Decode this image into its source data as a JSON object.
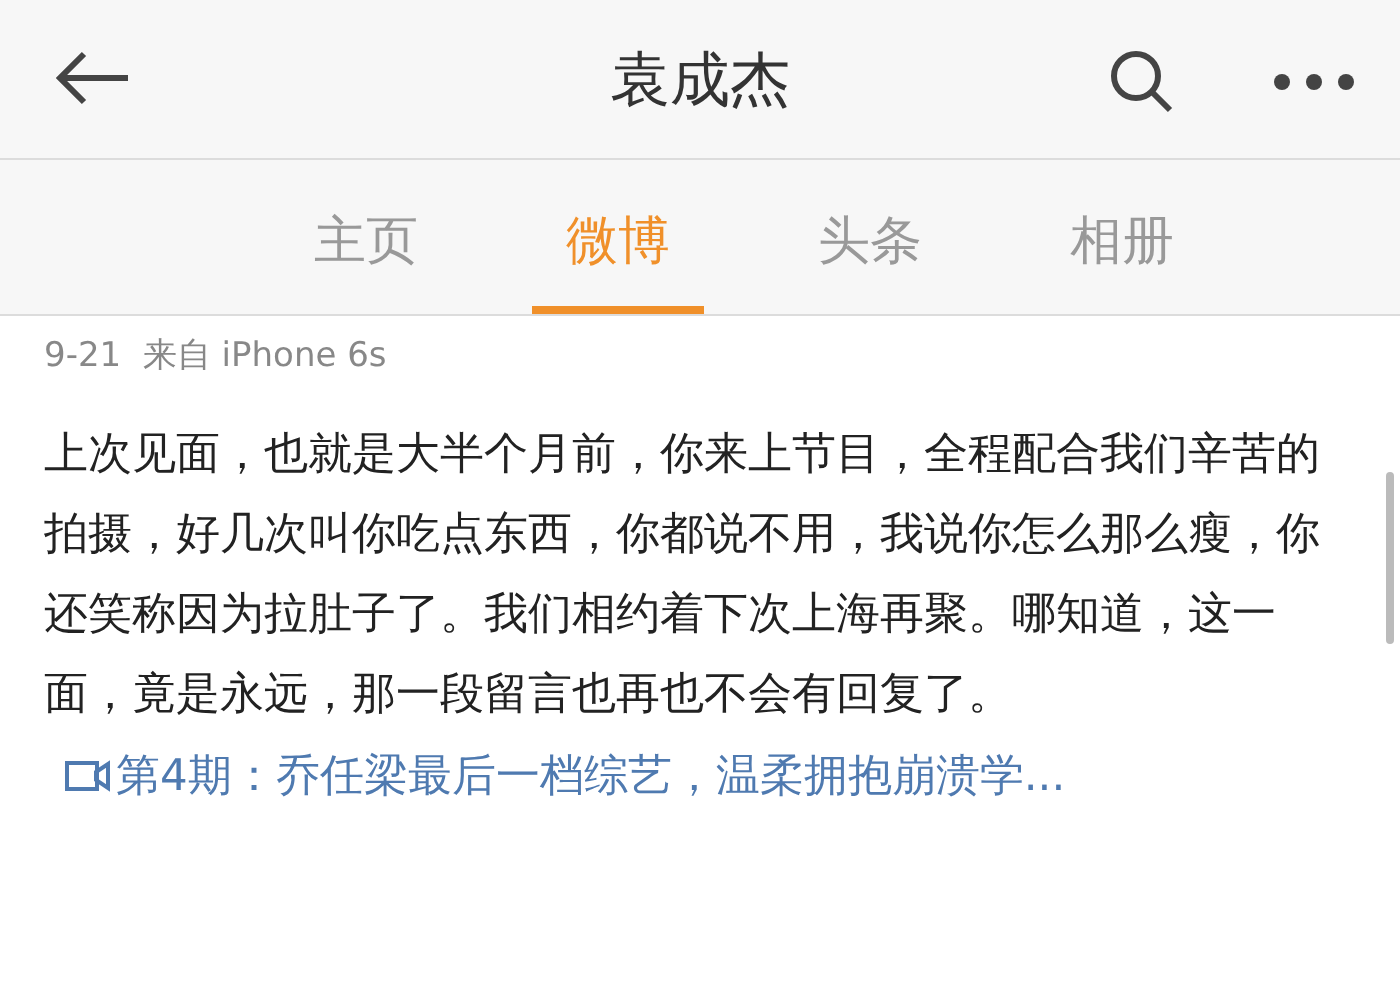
{
  "header": {
    "title": "袁成杰"
  },
  "tabs": [
    {
      "label": "主页",
      "selected": false
    },
    {
      "label": "微博",
      "selected": true
    },
    {
      "label": "头条",
      "selected": false
    },
    {
      "label": "相册",
      "selected": false
    }
  ],
  "post": {
    "meta": "9-21  来自 iPhone 6s",
    "text": "上次见面，也就是大半个月前，你来上节目，全程配合我们辛苦的拍摄，好几次叫你吃点东西，你都说不用，我说你怎么那么瘦，你还笑称因为拉肚子了。我们相约着下次上海再聚。哪知道，这一面，竟是永远，那一段留言也再也不会有回复了。",
    "link": "第4期：乔任梁最后一档综艺，温柔拥抱崩溃学..."
  }
}
